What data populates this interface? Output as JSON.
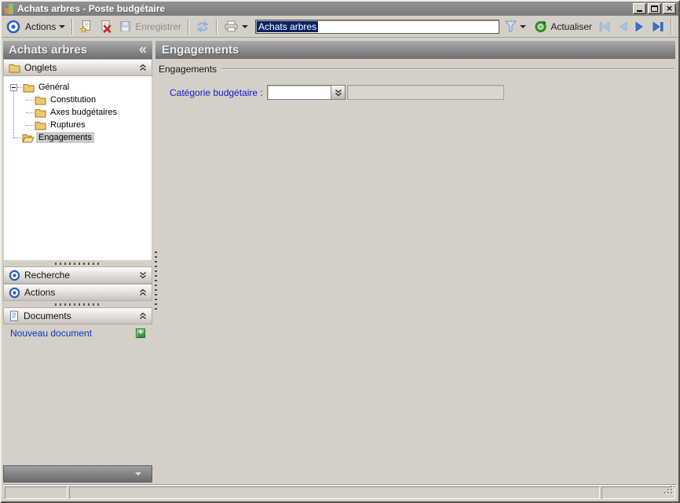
{
  "window": {
    "title": "Achats arbres -  Poste budgétaire"
  },
  "toolbar": {
    "actions_label": "Actions",
    "save_label": "Enregistrer",
    "record_title_value": "Achats arbres",
    "refresh_label": "Actualiser"
  },
  "sidebar": {
    "title": "Achats arbres",
    "sections": {
      "onglets": "Onglets",
      "recherche": "Recherche",
      "actions": "Actions",
      "documents": "Documents"
    },
    "tree": {
      "items": [
        {
          "label": "Général",
          "level": 0,
          "expanded": true,
          "selected": false
        },
        {
          "label": "Constitution",
          "level": 1,
          "selected": false
        },
        {
          "label": "Axes budgétaires",
          "level": 1,
          "selected": false
        },
        {
          "label": "Ruptures",
          "level": 1,
          "selected": false
        },
        {
          "label": "Engagements",
          "level": 0,
          "selected": true
        }
      ]
    },
    "documents_panel": {
      "new_document_label": "Nouveau document"
    }
  },
  "main": {
    "header": "Engagements",
    "group_label": "Engagements",
    "category_field": {
      "label": "Catégorie budgétaire :",
      "combo_value": "",
      "detail_value": ""
    }
  },
  "statusbar": {
    "left": "",
    "center": "",
    "right": ""
  },
  "colors": {
    "window_bg": "#d4d0c8",
    "titlebar_gray": "#858585",
    "header_gradient_top": "#ababab",
    "header_gradient_bottom": "#6e6e6e",
    "text_selection_bg": "#0a246a",
    "link_blue": "#0a32c8",
    "field_label_blue": "#1616c8",
    "tree_selection_gray": "#cbcbcb",
    "new_doc_green": "#3a9e3a",
    "nav_enabled_blue": "#3076d2",
    "nav_disabled_blue": "#aac6e6"
  },
  "icons": {
    "app": "mini-bar-chart",
    "actions": "blue-target",
    "new": "document-with-star",
    "delete": "document-with-red-x",
    "save": "floppy-disk",
    "refresh_data": "blue-arrows",
    "print": "printer",
    "filter": "funnel",
    "actualiser": "green-refresh-ring",
    "documents": "document-lines",
    "folder": "yellow-folder"
  }
}
